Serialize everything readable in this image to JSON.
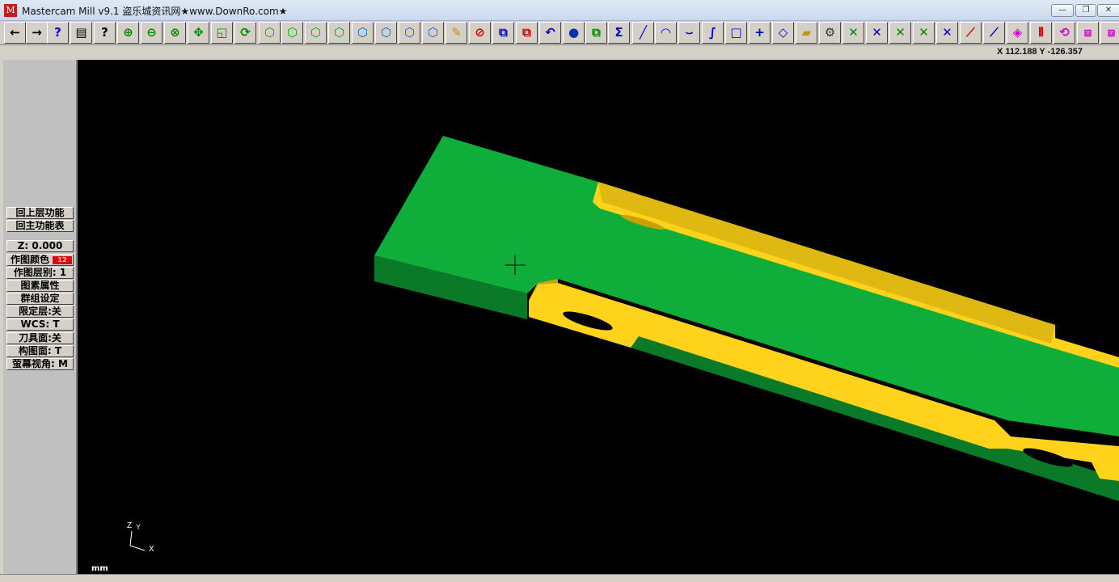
{
  "window": {
    "title": "Mastercam Mill v9.1 盗乐城资讯网★www.DownRo.com★",
    "app_icon": "mastercam-logo",
    "minimize_glyph": "—",
    "maximize_glyph": "❐",
    "close_glyph": "✕"
  },
  "toolbar": {
    "buttons": [
      {
        "name": "back-arrow-icon",
        "glyph": "←"
      },
      {
        "name": "forward-arrow-icon",
        "glyph": "→"
      },
      {
        "name": "help-icon",
        "glyph": "?"
      },
      {
        "name": "analyze-icon",
        "glyph": "▤"
      },
      {
        "name": "query-icon",
        "glyph": "?"
      },
      {
        "name": "zoom-window-icon",
        "glyph": "⊕"
      },
      {
        "name": "zoom-out-icon",
        "glyph": "⊖"
      },
      {
        "name": "zoom-icon",
        "glyph": "⊗"
      },
      {
        "name": "pan-icon",
        "glyph": "✥"
      },
      {
        "name": "fit-icon",
        "glyph": "◱"
      },
      {
        "name": "rotate-icon",
        "glyph": "⟳"
      },
      {
        "name": "view-top-icon",
        "glyph": "⬡"
      },
      {
        "name": "view-front-icon",
        "glyph": "⬡"
      },
      {
        "name": "view-side-icon",
        "glyph": "⬡"
      },
      {
        "name": "view-iso-icon",
        "glyph": "⬡"
      },
      {
        "name": "cplane-top-icon",
        "glyph": "⬡"
      },
      {
        "name": "cplane-front-icon",
        "glyph": "⬡"
      },
      {
        "name": "cplane-side-icon",
        "glyph": "⬡"
      },
      {
        "name": "cplane-3d-icon",
        "glyph": "⬡"
      },
      {
        "name": "shade-icon",
        "glyph": "✎"
      },
      {
        "name": "delete-icon",
        "glyph": "⊘"
      },
      {
        "name": "screen-icon",
        "glyph": "⧉"
      },
      {
        "name": "regen-icon",
        "glyph": "⧉"
      },
      {
        "name": "undo-icon",
        "glyph": "↶"
      },
      {
        "name": "sphere-icon",
        "glyph": "●"
      },
      {
        "name": "group-icon",
        "glyph": "⧉"
      },
      {
        "name": "sum-icon",
        "glyph": "Σ"
      },
      {
        "name": "line-icon",
        "glyph": "╱"
      },
      {
        "name": "arc-icon",
        "glyph": "◠"
      },
      {
        "name": "fillet-icon",
        "glyph": "⌣"
      },
      {
        "name": "spline-icon",
        "glyph": "∫"
      },
      {
        "name": "rectangle-icon",
        "glyph": "□"
      },
      {
        "name": "point-icon",
        "glyph": "+"
      },
      {
        "name": "surface-icon",
        "glyph": "◇"
      },
      {
        "name": "solid-icon",
        "glyph": "▰"
      },
      {
        "name": "toolpath-icon",
        "glyph": "⚙"
      },
      {
        "name": "trim-icon",
        "glyph": "✕"
      },
      {
        "name": "trim-two-icon",
        "glyph": "✕"
      },
      {
        "name": "trim-three-icon",
        "glyph": "✕"
      },
      {
        "name": "break-icon",
        "glyph": "✕"
      },
      {
        "name": "extend-icon",
        "glyph": "✕"
      },
      {
        "name": "join-icon",
        "glyph": "⟋"
      },
      {
        "name": "modify-icon",
        "glyph": "⟋"
      },
      {
        "name": "xform-icon",
        "glyph": "◈"
      },
      {
        "name": "mirror-icon",
        "glyph": "⫴"
      },
      {
        "name": "rotate-xform-icon",
        "glyph": "⟲"
      },
      {
        "name": "scale-icon",
        "glyph": "⧈"
      },
      {
        "name": "translate-icon",
        "glyph": "⧈"
      },
      {
        "name": "offset-icon",
        "glyph": "⊢"
      }
    ]
  },
  "coords": {
    "readout": "X 112.188  Y -126.357"
  },
  "menu": {
    "back_label": "回上层功能",
    "main_label": "回主功能表",
    "z_label": "Z:  0.000",
    "color_label": "作图颜色",
    "color_value": "12",
    "color_hex": "#e00010",
    "layer_label": "作图层别:  1",
    "attributes_label": "图素属性",
    "group_label": "群组设定",
    "limit_layer_label": "限定层:关",
    "wcs_label": "WCS:  T",
    "tool_plane_label": "刀具面:关",
    "construct_plane_label": "构图面:  T",
    "screen_view_label": "萤幕视角:  M"
  },
  "viewport": {
    "background": "#000000",
    "part_green": "#0fae3a",
    "part_green_dark": "#0a7a28",
    "part_yellow": "#ffd21c",
    "part_yellow_dark": "#c9a200",
    "axis_z": "Z",
    "axis_y": "Y",
    "axis_x": "X",
    "units": "mm"
  }
}
